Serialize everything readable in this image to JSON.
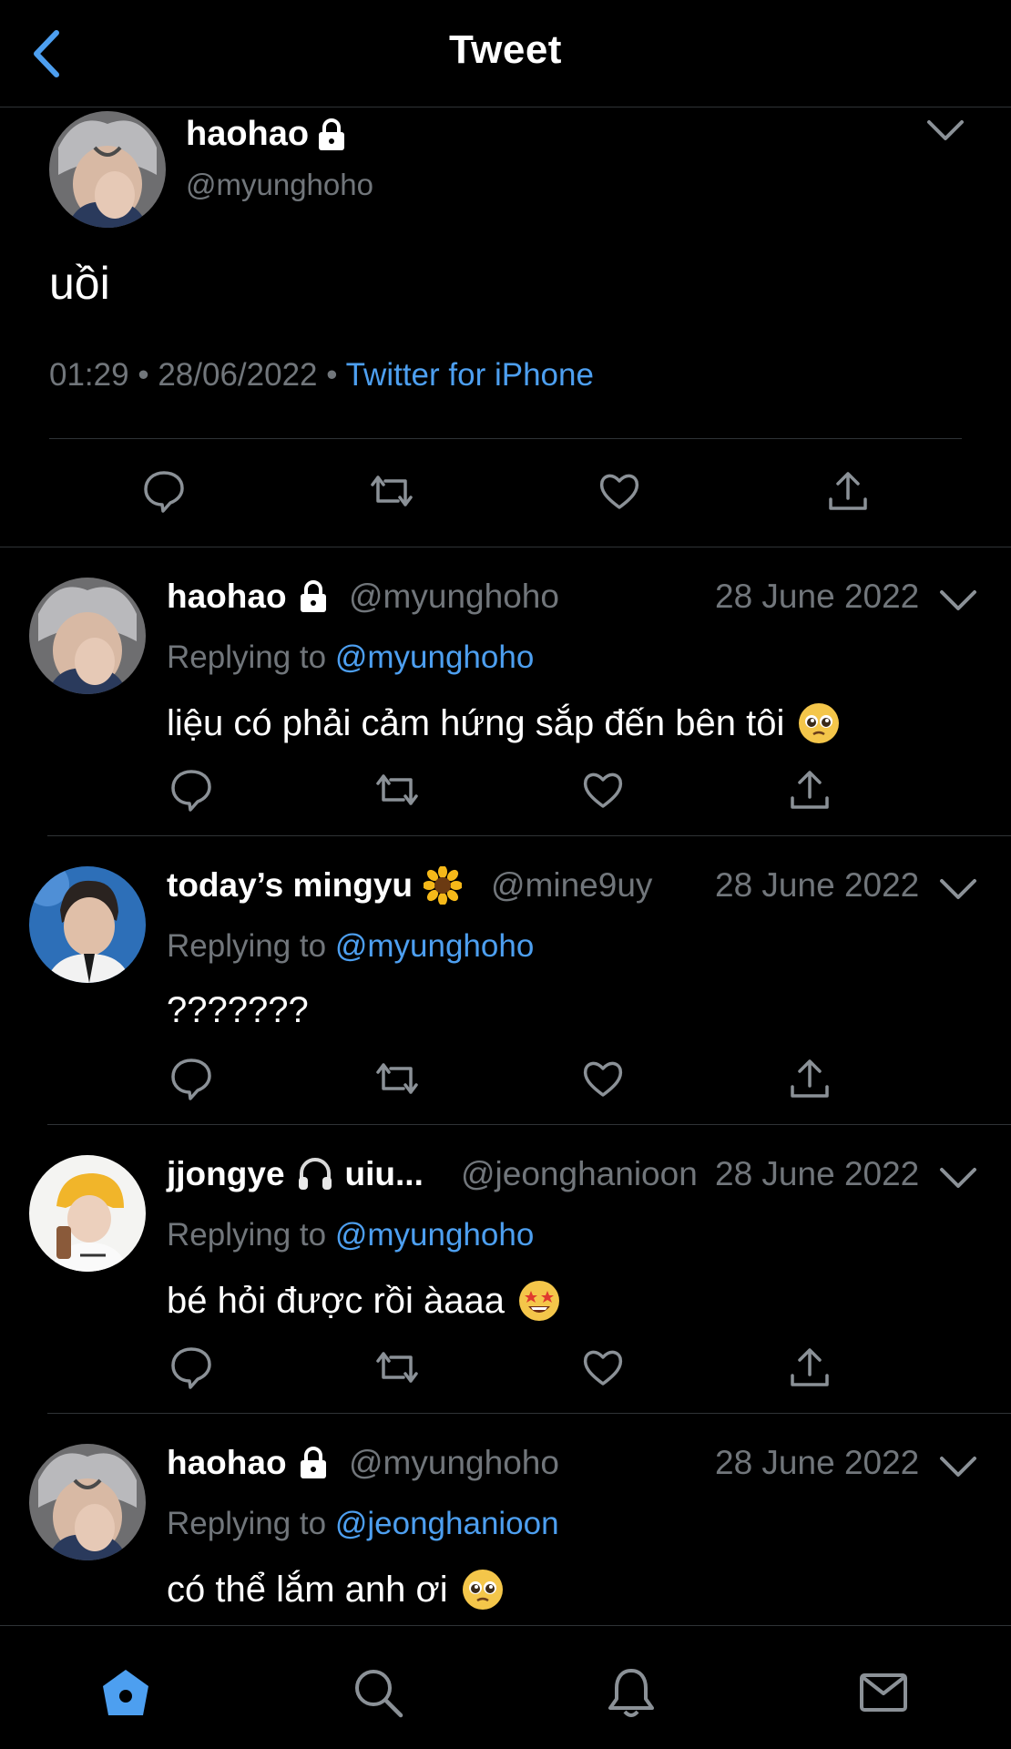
{
  "header": {
    "title": "Tweet",
    "back_icon": "chevron-left-icon"
  },
  "colors": {
    "background": "#000000",
    "accent": "#4d9ff0",
    "muted": "#71767b",
    "divider": "#2f3336"
  },
  "main_tweet": {
    "name": "haohao",
    "handle": "@myunghoho",
    "text": "uồi",
    "time": "01:29",
    "date": "28/06/2022",
    "source": "Twitter for iPhone",
    "separator": "•"
  },
  "replies": [
    {
      "name": "haohao",
      "handle": "@myunghoho",
      "date": "28 June 2022",
      "replying_label": "Replying to",
      "replying_to": "@myunghoho",
      "text": "liệu có phải cảm hứng sắp đến bên tôi",
      "emoji": "pleading-face"
    },
    {
      "name": "today’s mingyu",
      "handle": "@mine9uy",
      "date": "28 June 2022",
      "replying_label": "Replying to",
      "replying_to": "@myunghoho",
      "text": "???????",
      "emoji": ""
    },
    {
      "name": "jjongye",
      "name_suffix": "uiu...",
      "handle": "@jeonghanioon",
      "date": "28 June 2022",
      "replying_label": "Replying to",
      "replying_to": "@myunghoho",
      "text": "bé hỏi được rồi àaaa",
      "emoji": "star-struck"
    },
    {
      "name": "haohao",
      "handle": "@myunghoho",
      "date": "28 June 2022",
      "replying_label": "Replying to",
      "replying_to": "@jeonghanioon",
      "text": "có thể lắm anh ơi",
      "emoji": "pleading-face"
    }
  ],
  "tabbar": [
    "home-icon",
    "search-icon",
    "notifications-icon",
    "messages-icon"
  ]
}
